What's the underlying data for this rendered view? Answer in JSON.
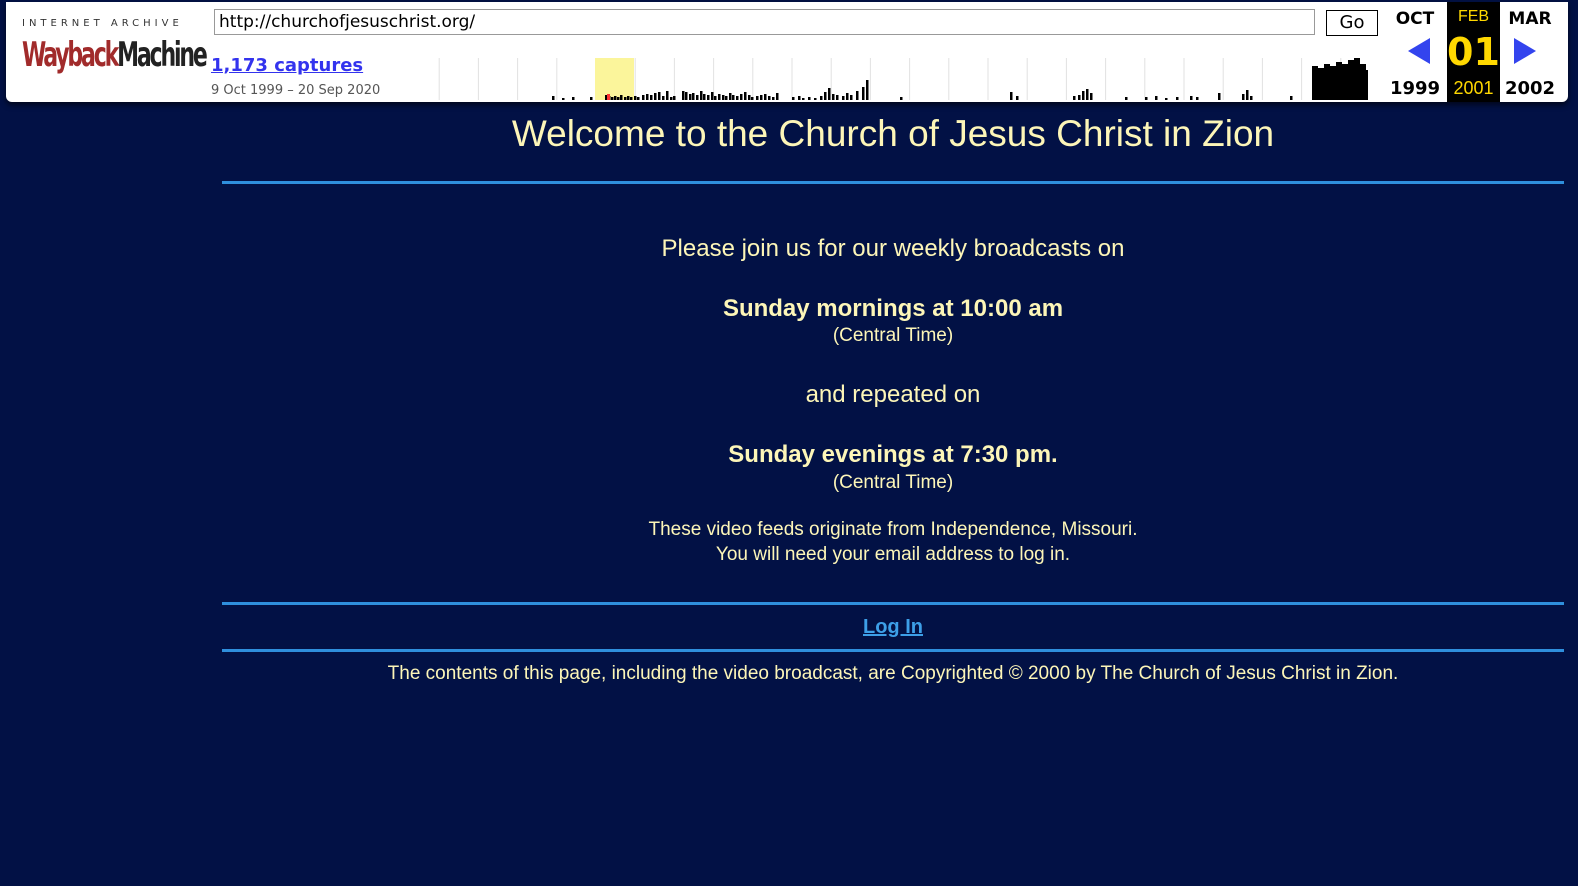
{
  "wayback": {
    "logo_top": "INTERNET ARCHIVE",
    "logo_part1": "Wayback",
    "logo_part2": "Machine",
    "url": "http://churchofjesuschrist.org/",
    "go_label": "Go",
    "captures": "1,173 captures",
    "range": "9 Oct 1999 – 20 Sep 2020",
    "prev_month": "OCT",
    "prev_year": "1999",
    "cur_month": "FEB",
    "cur_day": "01",
    "cur_year": "2001",
    "next_month": "MAR",
    "next_year": "2002",
    "colors": {
      "highlight": "#ffd800",
      "arrow": "#3344ee",
      "captures_link": "#3333ee"
    }
  },
  "page": {
    "title": "Welcome to the Church of Jesus Christ in Zion",
    "join": "Please join us for our weekly broadcasts on",
    "morning": "Sunday mornings at 10:00 am",
    "central1": "(Central Time)",
    "repeated": "and repeated on",
    "evening": "Sunday evenings at 7:30 pm.",
    "central2": "(Central Time)",
    "feed1": "These video feeds originate from Independence, Missouri.",
    "feed2": "You will need your email address to log in.",
    "login": "Log In",
    "copyright": "The contents of this page, including the video broadcast, are Copyrighted © 2000 by The Church of Jesus Christ in Zion.",
    "colors": {
      "background": "#021145",
      "text": "#fdf6b8",
      "rule": "#2f8fdd",
      "link": "#3d9fe8"
    }
  }
}
